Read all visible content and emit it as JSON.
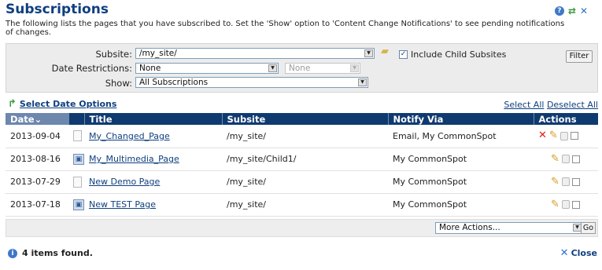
{
  "header": {
    "title": "Subscriptions",
    "description": "The following lists the pages that you have subscribed to. Set the 'Show' option to 'Content Change Notifications' to see pending notifications of changes."
  },
  "filter": {
    "subsite_label": "Subsite:",
    "subsite_value": "/my_site/",
    "include_child_label": "Include Child Subsites",
    "include_child_checked": true,
    "date_restrictions_label": "Date Restrictions:",
    "date_restrictions_value": "None",
    "date_restrictions_secondary": "None",
    "show_label": "Show:",
    "show_value": "All Subscriptions",
    "filter_button": "Filter"
  },
  "links": {
    "select_date_options": "Select Date Options",
    "select_all": "Select All",
    "deselect_all": "Deselect All"
  },
  "table": {
    "columns": [
      "Date",
      "Title",
      "Subsite",
      "Notify Via",
      "Actions"
    ],
    "sort_indicator": "⌄",
    "rows": [
      {
        "date": "2013-09-04",
        "icon": "page-icon",
        "title": "My_Changed_Page",
        "subsite": "/my_site/",
        "notify": "Email, My CommonSpot",
        "has_delete": true
      },
      {
        "date": "2013-08-16",
        "icon": "multimedia-icon",
        "title": "My_Multimedia_Page",
        "subsite": "/my_site/Child1/",
        "notify": "My CommonSpot",
        "has_delete": false
      },
      {
        "date": "2013-07-29",
        "icon": "page-icon",
        "title": "New Demo Page",
        "subsite": "/my_site/",
        "notify": "My CommonSpot",
        "has_delete": false
      },
      {
        "date": "2013-07-18",
        "icon": "multimedia-icon",
        "title": "New TEST Page",
        "subsite": "/my_site/",
        "notify": "My CommonSpot",
        "has_delete": false
      }
    ]
  },
  "bottom": {
    "more_actions": "More Actions...",
    "go": "Go",
    "items_found": "4 items found.",
    "close": "Close"
  },
  "icons": {
    "help": "help-icon",
    "refresh": "refresh-icon",
    "close": "close-icon",
    "folder": "folder-icon",
    "delete": "delete-icon",
    "edit": "pencil-icon",
    "lock": "lock-icon"
  },
  "colors": {
    "header_bg": "#0f3a70",
    "title": "#0f3f7f",
    "link": "#0f3f7f",
    "delete": "#e01c1c"
  }
}
